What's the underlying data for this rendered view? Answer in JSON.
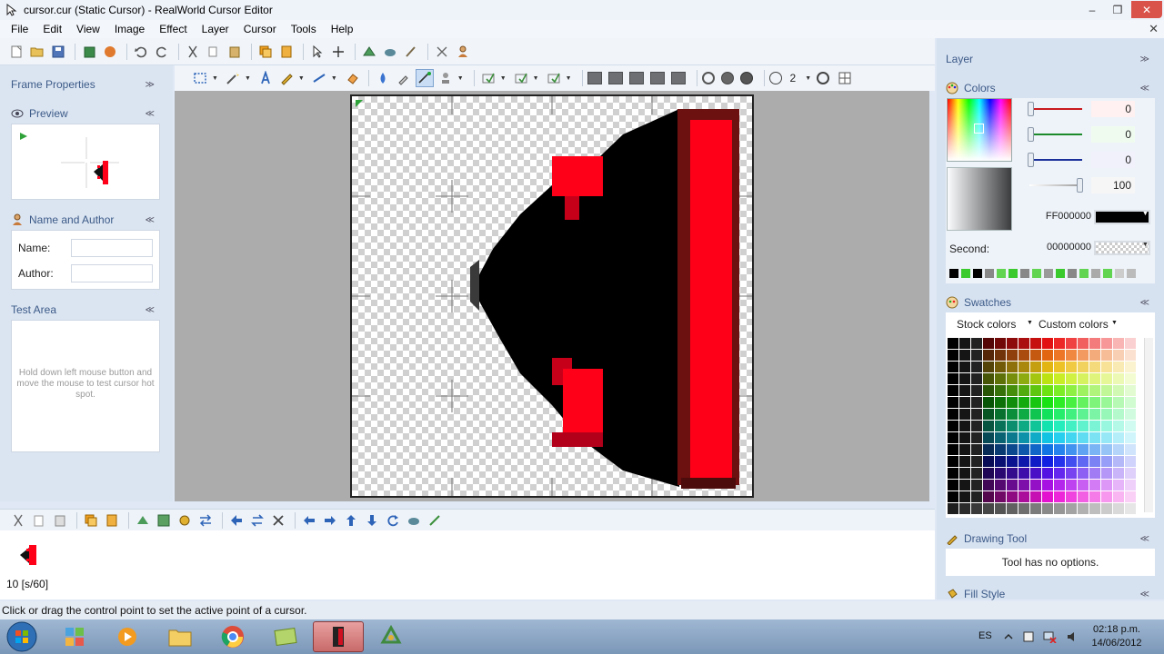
{
  "window": {
    "title": "cursor.cur (Static Cursor) - RealWorld Cursor Editor",
    "minimize": "–",
    "maximize": "❒",
    "close": "✕"
  },
  "menu": [
    "File",
    "Edit",
    "View",
    "Image",
    "Effect",
    "Layer",
    "Cursor",
    "Tools",
    "Help"
  ],
  "menu_close_doc": "✕",
  "left_panels": {
    "frame_properties": "Frame Properties",
    "preview": "Preview",
    "name_author": {
      "title": "Name and Author",
      "name_label": "Name:",
      "name_value": "",
      "author_label": "Author:",
      "author_value": ""
    },
    "test_area": {
      "title": "Test Area",
      "hint": "Hold down left mouse button and move the mouse to test cursor hot spot."
    }
  },
  "toolbar_draw": {
    "brush_size": "2"
  },
  "frames": {
    "label": "10 [s/60]"
  },
  "right_panels": {
    "layer": "Layer",
    "colors": {
      "title": "Colors",
      "red": "0",
      "green": "0",
      "blue": "0",
      "alpha": "100",
      "primary_hex": "FF000000",
      "second_label": "Second:",
      "second_hex": "00000000"
    },
    "swatches": {
      "title": "Swatches",
      "stock": "Stock colors",
      "custom": "Custom colors"
    },
    "drawing_tool": {
      "title": "Drawing Tool",
      "message": "Tool has no options."
    },
    "fill_style": "Fill Style"
  },
  "status": "Click or drag the control point to set the active point of a cursor.",
  "taskbar": {
    "lang": "ES",
    "time": "02:18 p.m.",
    "date": "14/06/2012"
  },
  "colors": {
    "accent_red": "#ff0019",
    "panel_header": "#3c5a87"
  },
  "icons": {
    "app": "cursor-app-icon",
    "preview": "eye-icon",
    "play": "play-icon",
    "colors": "palette-icon",
    "swatches": "swatches-icon",
    "drawing": "pencil-icon",
    "fill": "bucket-icon",
    "user": "user-icon"
  }
}
